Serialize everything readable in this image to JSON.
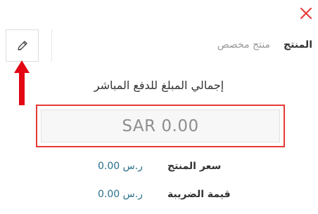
{
  "header": {
    "product_label": "المنتج",
    "custom_product": "منتج مخصص"
  },
  "icons": {
    "close": "close-icon",
    "edit": "pencil-icon"
  },
  "colors": {
    "close": "#e53935",
    "highlight": "#e53935",
    "arrow": "#e30613",
    "value": "#2a6f8a"
  },
  "payment": {
    "total_label": "إجمالي المبلغ للدفع المباشر",
    "amount": "SAR 0.00"
  },
  "summary": [
    {
      "label": "سعر المنتج",
      "value": "0.00 ر.س"
    },
    {
      "label": "قيمة الضريبة",
      "value": "0.00 ر.س"
    }
  ]
}
